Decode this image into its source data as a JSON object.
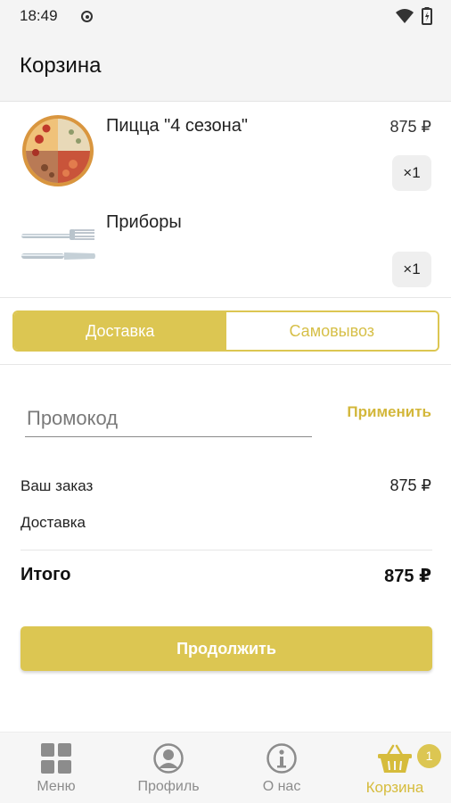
{
  "status_bar": {
    "time": "18:49"
  },
  "header": {
    "title": "Корзина"
  },
  "cart": {
    "items": [
      {
        "name": "Пицца \"4 сезона\"",
        "price": "875 ₽",
        "qty": "×1",
        "image": "pizza-image"
      },
      {
        "name": "Приборы",
        "price": "",
        "qty": "×1",
        "image": "cutlery-image"
      }
    ]
  },
  "delivery_toggle": {
    "options": [
      "Доставка",
      "Самовывоз"
    ],
    "selected": "Доставка"
  },
  "promo": {
    "placeholder": "Промокод",
    "value": "",
    "apply_label": "Применить"
  },
  "summary": {
    "order_label": "Ваш заказ",
    "order_value": "875 ₽",
    "delivery_label": "Доставка",
    "delivery_value": "",
    "total_label": "Итого",
    "total_value": "875 ₽"
  },
  "continue_label": "Продолжить",
  "bottom_nav": {
    "items": [
      {
        "label": "Меню",
        "icon": "grid-icon"
      },
      {
        "label": "Профиль",
        "icon": "profile-icon"
      },
      {
        "label": "О нас",
        "icon": "info-icon"
      },
      {
        "label": "Корзина",
        "icon": "basket-icon",
        "active": true
      }
    ],
    "cart_badge": "1"
  },
  "colors": {
    "accent": "#dcc652",
    "accent_text": "#d3b73a"
  }
}
